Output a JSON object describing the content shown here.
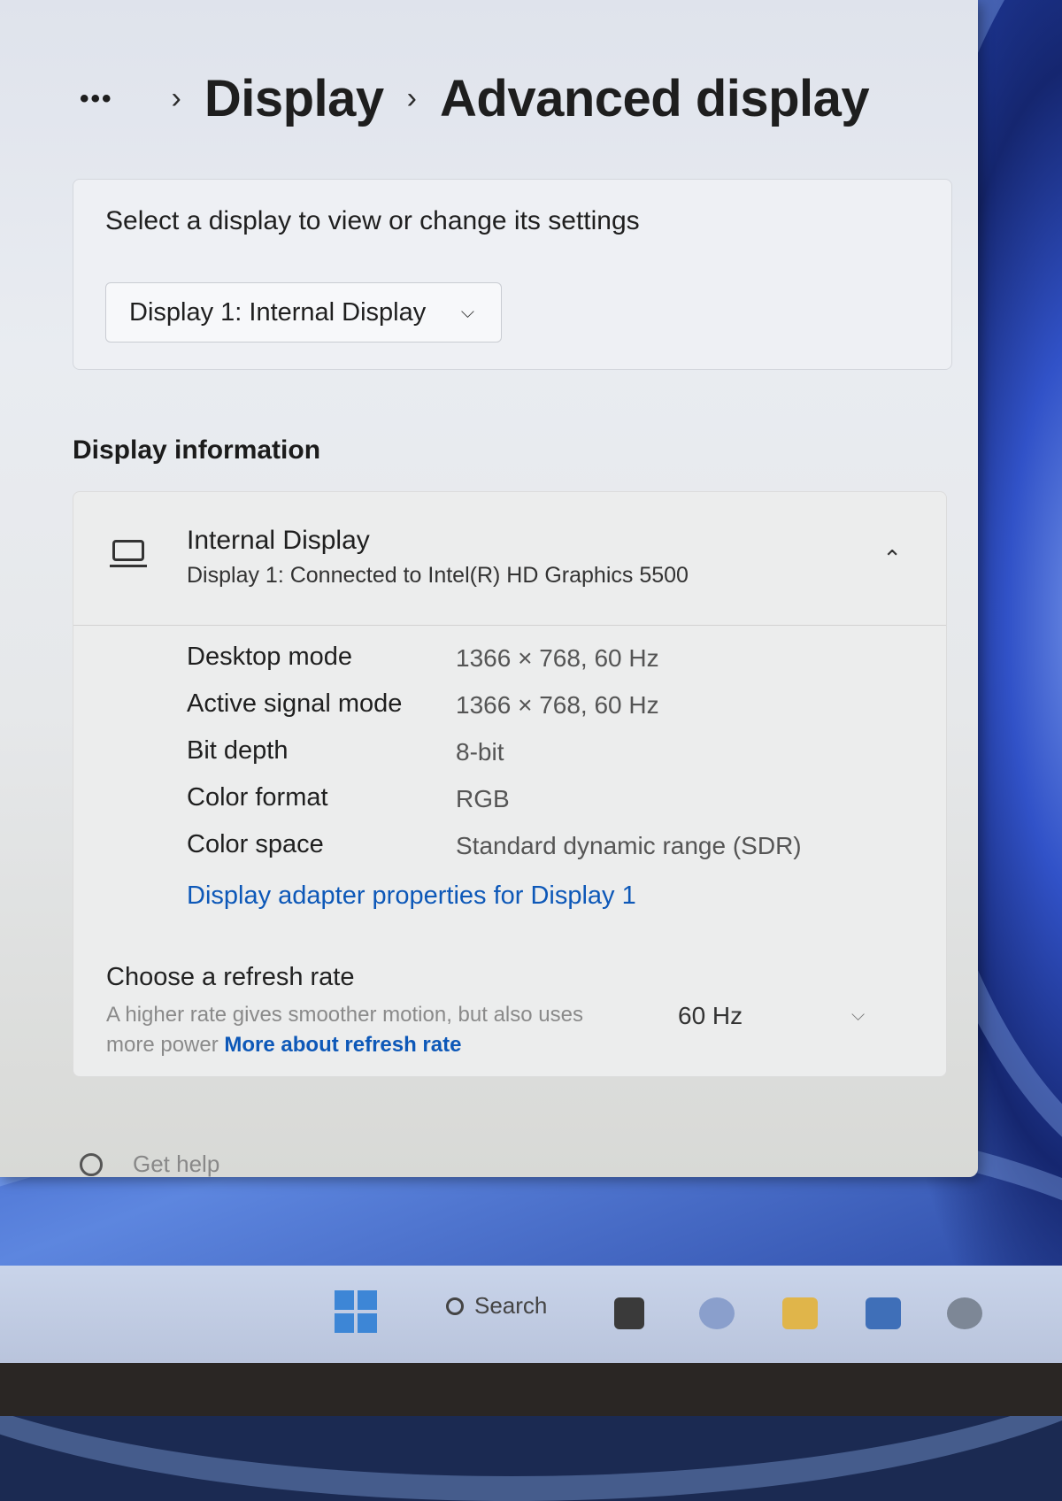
{
  "breadcrumb": {
    "more": "•••",
    "sep": "›",
    "items": [
      "Display",
      "Advanced display"
    ]
  },
  "select_display": {
    "prompt": "Select a display to view or change its settings",
    "selected": "Display 1: Internal Display"
  },
  "display_information": {
    "title": "Display information",
    "name": "Internal Display",
    "subtitle": "Display 1: Connected to Intel(R) HD Graphics 5500",
    "properties": [
      {
        "label": "Desktop mode",
        "value": "1366 × 768, 60 Hz"
      },
      {
        "label": "Active signal mode",
        "value": "1366 × 768, 60 Hz"
      },
      {
        "label": "Bit depth",
        "value": "8-bit"
      },
      {
        "label": "Color format",
        "value": "RGB"
      },
      {
        "label": "Color space",
        "value": "Standard dynamic range (SDR)"
      }
    ],
    "adapter_link": "Display adapter properties for Display 1"
  },
  "refresh_rate": {
    "title": "Choose a refresh rate",
    "description": "A higher rate gives smoother motion, but also uses more power",
    "link": "More about refresh rate",
    "value": "60 Hz"
  },
  "help": {
    "label": "Get help"
  },
  "taskbar": {
    "search": "Search"
  },
  "colors": {
    "accent_link": "#0d58b8",
    "start": "#3d86d6"
  }
}
